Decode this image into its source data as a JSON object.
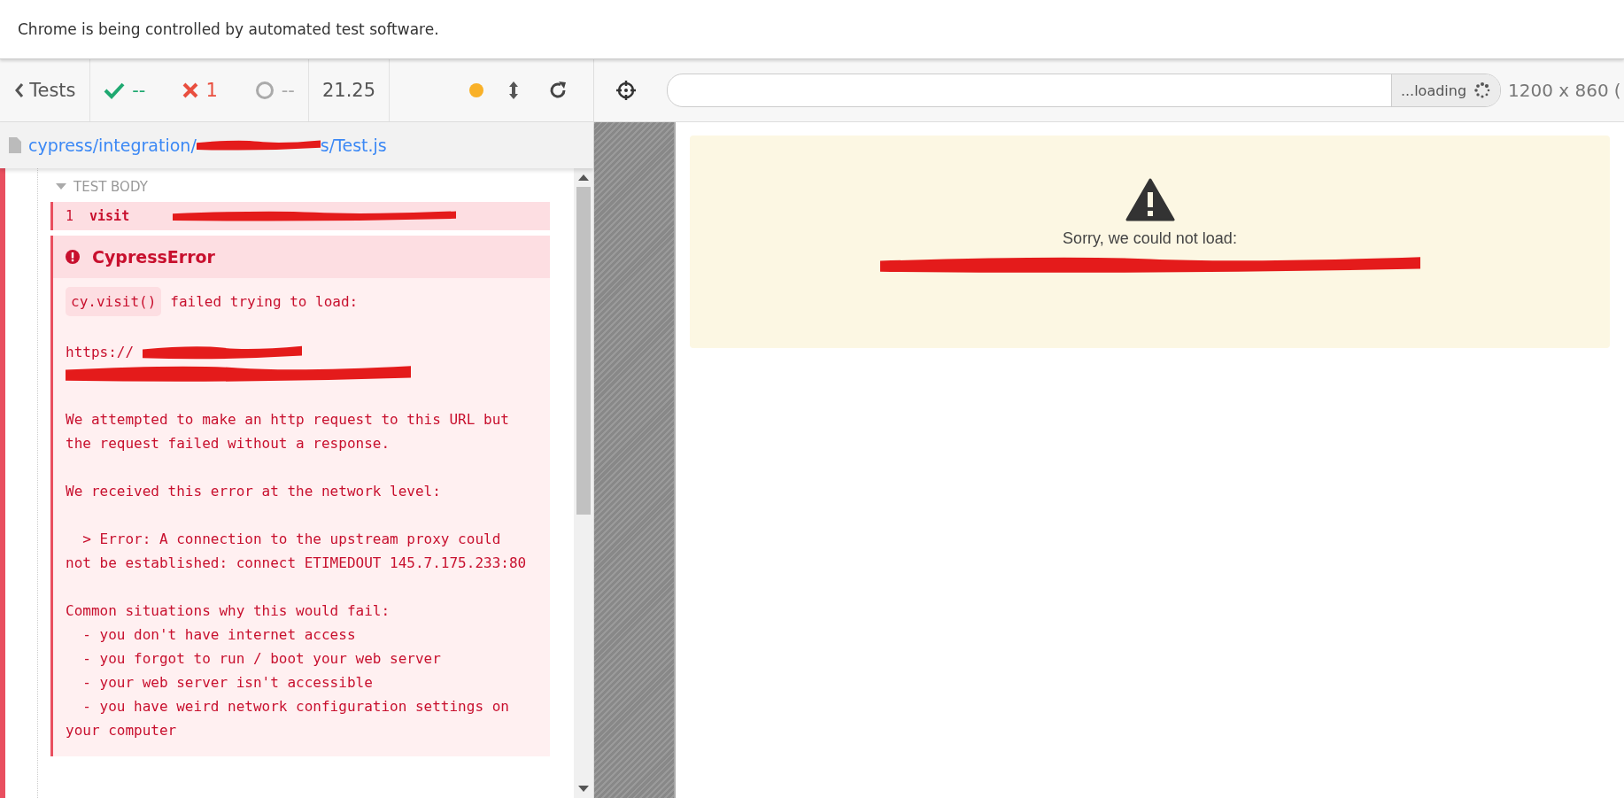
{
  "banner": {
    "text": "Chrome is being controlled by automated test software."
  },
  "reporter": {
    "back_label": "Tests",
    "passed": "--",
    "failed": "1",
    "pending": "--",
    "duration": "21.25",
    "running": true
  },
  "spec": {
    "path_start": "cypress/integration/",
    "path_end": "s/Test.js"
  },
  "test_body": {
    "title": "TEST BODY",
    "expanded": true,
    "commands": [
      {
        "number": "1",
        "name": "visit",
        "failed": true
      }
    ]
  },
  "error": {
    "title": "CypressError",
    "code": "cy.visit()",
    "lead": "failed trying to load:",
    "url_start": "https://",
    "paragraphs": [
      "We attempted to make an http request to this URL but the request failed without a response.",
      "We received this error at the network level:",
      "  > Error: A connection to the upstream proxy could not be established: connect ETIMEDOUT 145.7.175.233:80",
      "Common situations why this would fail:\n  - you don't have internet access\n  - you forgot to run / boot your web server\n  - your web server isn't accessible\n  - you have weird network configuration settings on your computer"
    ]
  },
  "aut": {
    "status": "...loading",
    "size": "1200 x 860",
    "size_extra": "("
  },
  "page": {
    "message": "Sorry, we could not load:"
  }
}
